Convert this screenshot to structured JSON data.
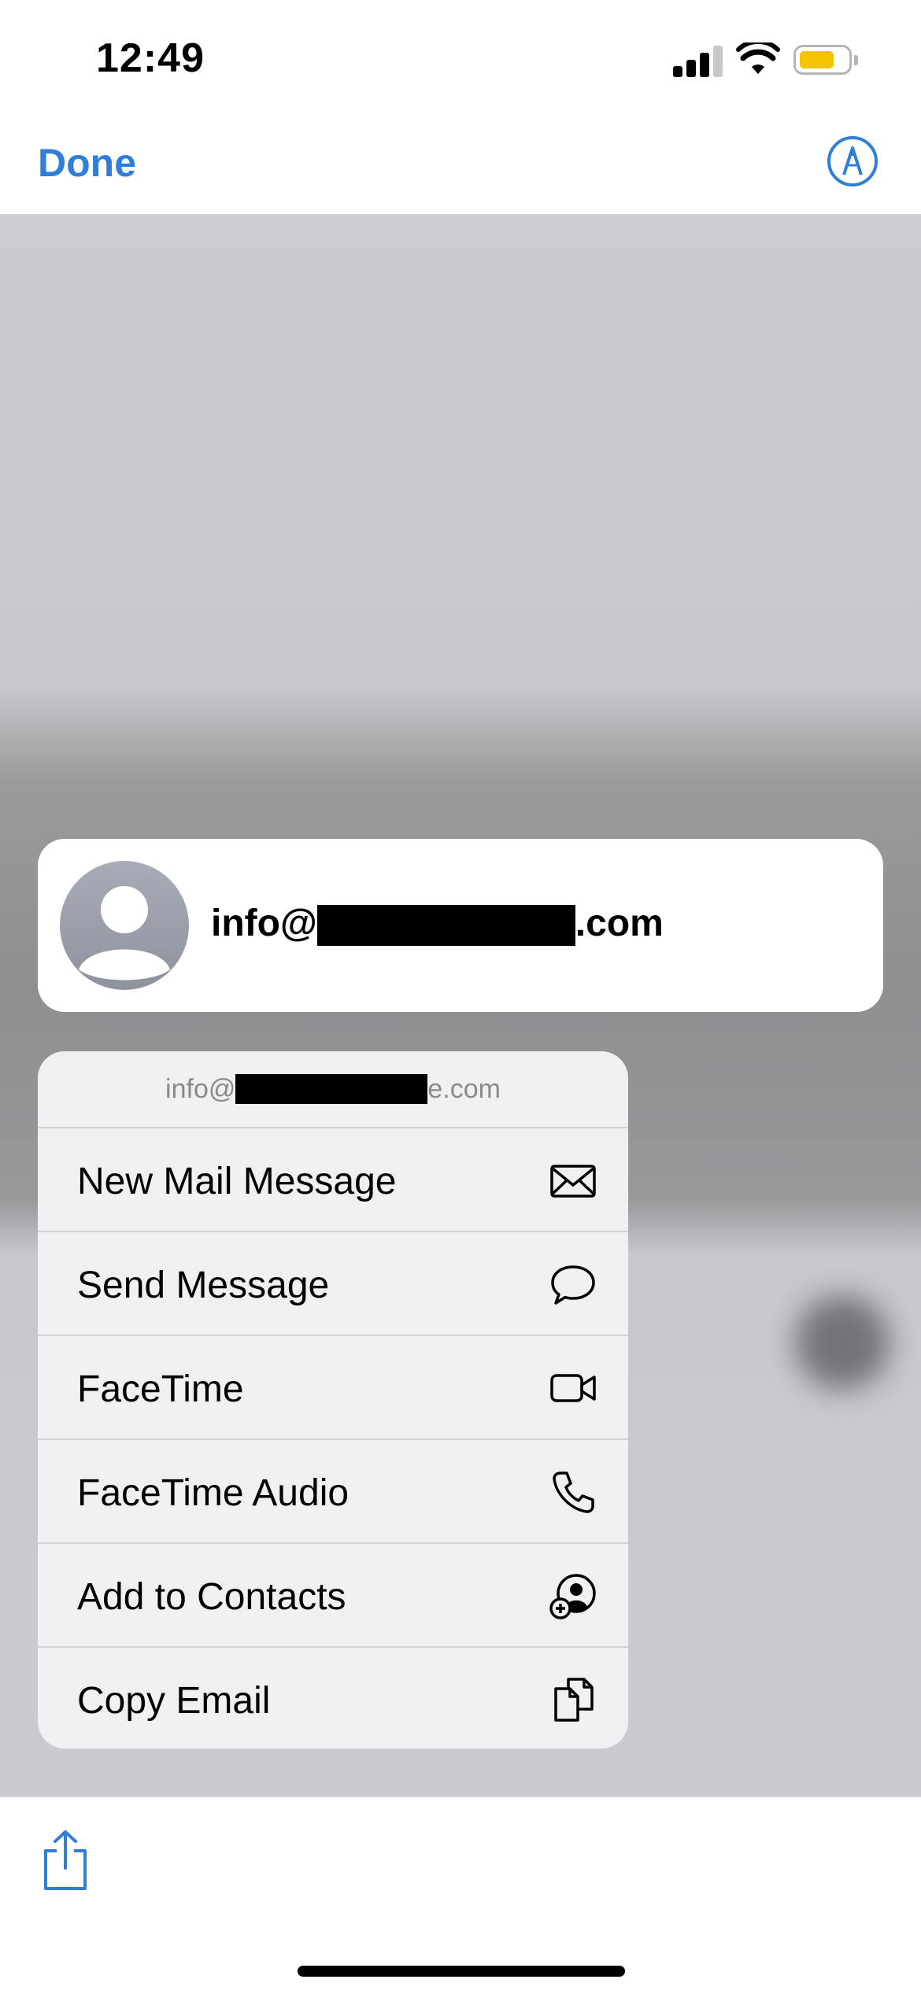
{
  "status_bar": {
    "time": "12:49",
    "icons": [
      "signal-icon",
      "wifi-icon",
      "battery-icon"
    ],
    "battery_color": "#f5c400"
  },
  "nav_bar": {
    "done_label": "Done",
    "markup_icon": "markup-pen-icon",
    "accent_color": "#2f7fd8"
  },
  "contact_card": {
    "email_prefix": "info@",
    "email_suffix": ".com",
    "avatar_icon": "person-silhouette-icon"
  },
  "menu": {
    "header_prefix": "info@",
    "header_suffix": "e.com",
    "items": [
      {
        "label": "New Mail Message",
        "icon": "envelope-icon"
      },
      {
        "label": "Send Message",
        "icon": "chat-bubble-icon"
      },
      {
        "label": "FaceTime",
        "icon": "video-camera-icon"
      },
      {
        "label": "FaceTime Audio",
        "icon": "phone-icon"
      },
      {
        "label": "Add to Contacts",
        "icon": "add-contact-icon"
      },
      {
        "label": "Copy Email",
        "icon": "copy-documents-icon"
      }
    ]
  },
  "bottom_bar": {
    "share_icon": "share-icon"
  }
}
